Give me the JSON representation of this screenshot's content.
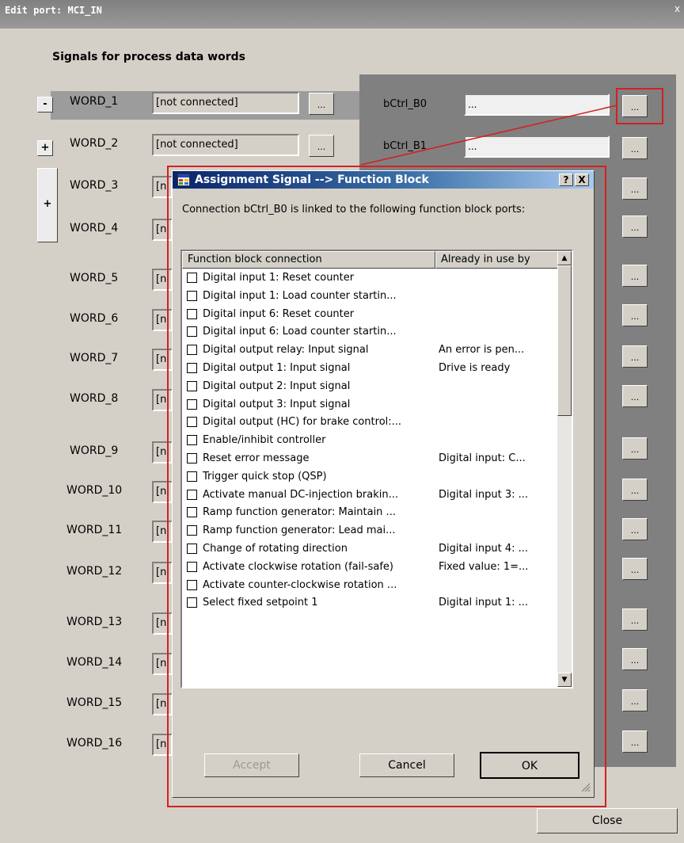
{
  "window": {
    "title": "Edit port: MCI_IN",
    "close_glyph": "x"
  },
  "section_title": "Signals for process data words",
  "words": [
    {
      "label": "WORD_1",
      "signal": "[not connected]",
      "button": "..."
    },
    {
      "label": "WORD_2",
      "signal": "[not connected]",
      "button": "..."
    },
    {
      "label": "WORD_3",
      "signal": "[n",
      "button": "..."
    },
    {
      "label": "WORD_4",
      "signal": "[n",
      "button": "..."
    },
    {
      "label": "WORD_5",
      "signal": "[n",
      "button": "..."
    },
    {
      "label": "WORD_6",
      "signal": "[n",
      "button": "..."
    },
    {
      "label": "WORD_7",
      "signal": "[n",
      "button": "..."
    },
    {
      "label": "WORD_8",
      "signal": "[n",
      "button": "..."
    },
    {
      "label": "WORD_9",
      "signal": "[n",
      "button": "..."
    },
    {
      "label": "WORD_10",
      "signal": "[n",
      "button": "..."
    },
    {
      "label": "WORD_11",
      "signal": "[n",
      "button": "..."
    },
    {
      "label": "WORD_12",
      "signal": "[n",
      "button": "..."
    },
    {
      "label": "WORD_13",
      "signal": "[n",
      "button": "..."
    },
    {
      "label": "WORD_14",
      "signal": "[n",
      "button": "..."
    },
    {
      "label": "WORD_15",
      "signal": "[n",
      "button": "..."
    },
    {
      "label": "WORD_16",
      "signal": "[n",
      "button": "..."
    }
  ],
  "collapse": {
    "minus": "-",
    "plus": "+",
    "group_plus": "+"
  },
  "right_rows": [
    {
      "label": "bCtrl_B0",
      "value": "...",
      "button": "..."
    },
    {
      "label": "bCtrl_B1",
      "value": "...",
      "button": "..."
    }
  ],
  "right_buttons": [
    "...",
    "...",
    "...",
    "...",
    "...",
    "...",
    "...",
    "...",
    "...",
    "...",
    "...",
    "...",
    "...",
    "..."
  ],
  "dialog": {
    "title": "Assignment Signal --> Function Block",
    "help_glyph": "?",
    "close_glyph": "X",
    "description": "Connection bCtrl_B0 is linked to the following function block ports:",
    "columns": [
      "Function block connection",
      "Already in use by"
    ],
    "rows": [
      {
        "name": "Digital input 1: Reset counter",
        "used_by": ""
      },
      {
        "name": "Digital input 1: Load counter startin...",
        "used_by": ""
      },
      {
        "name": "Digital input 6: Reset counter",
        "used_by": ""
      },
      {
        "name": "Digital input 6: Load counter startin...",
        "used_by": ""
      },
      {
        "name": "Digital output relay: Input signal",
        "used_by": "An error is pen..."
      },
      {
        "name": "Digital output 1: Input signal",
        "used_by": "Drive is ready"
      },
      {
        "name": "Digital output 2: Input signal",
        "used_by": ""
      },
      {
        "name": "Digital output 3: Input signal",
        "used_by": ""
      },
      {
        "name": "Digital output (HC) for brake control:...",
        "used_by": ""
      },
      {
        "name": "Enable/inhibit controller",
        "used_by": ""
      },
      {
        "name": "Reset error message",
        "used_by": "Digital input: C..."
      },
      {
        "name": "Trigger quick stop (QSP)",
        "used_by": ""
      },
      {
        "name": "Activate manual DC-injection brakin...",
        "used_by": "Digital input 3: ..."
      },
      {
        "name": "Ramp function generator: Maintain ...",
        "used_by": ""
      },
      {
        "name": "Ramp function generator: Lead mai...",
        "used_by": ""
      },
      {
        "name": "Change of rotating direction",
        "used_by": "Digital input 4: ..."
      },
      {
        "name": "Activate clockwise rotation (fail-safe)",
        "used_by": "Fixed value: 1=..."
      },
      {
        "name": "Activate counter-clockwise rotation ...",
        "used_by": ""
      },
      {
        "name": "Select fixed setpoint 1",
        "used_by": "Digital input 1: ..."
      }
    ],
    "scroll_up_glyph": "▲",
    "scroll_down_glyph": "▼",
    "buttons": {
      "accept": "Accept",
      "cancel": "Cancel",
      "ok": "OK"
    }
  },
  "close_button": "Close",
  "colors": {
    "highlight_red": "#d42020",
    "title_blue": "#0a246a",
    "panel_gray": "#808080",
    "window_bg": "#d4d0c8"
  },
  "icons": [
    "app-window-icon",
    "help-icon",
    "close-icon",
    "checkbox-icon",
    "scroll-up-icon",
    "scroll-down-icon",
    "resize-grip-icon",
    "plus-icon",
    "minus-icon"
  ]
}
